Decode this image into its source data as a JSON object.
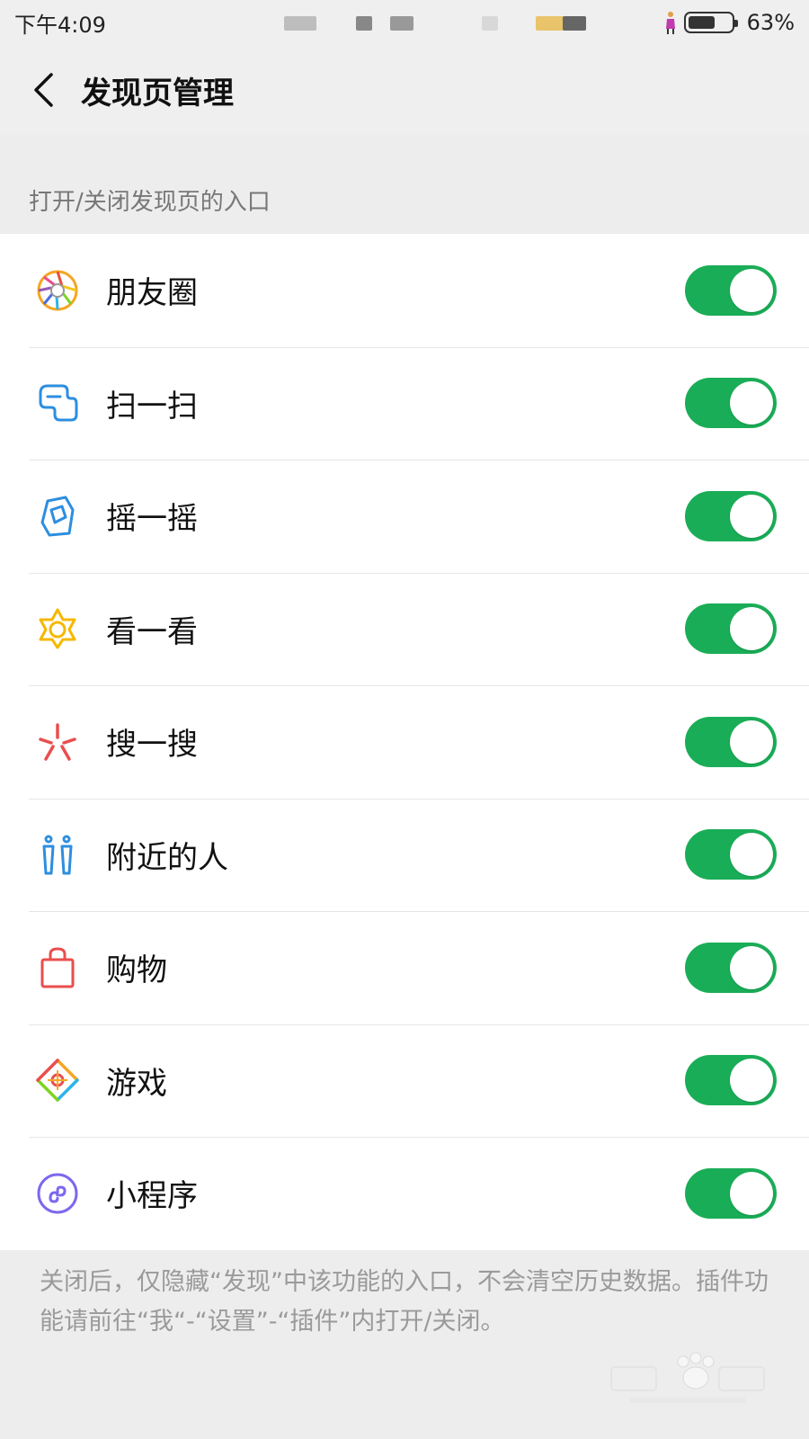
{
  "status": {
    "time": "下午4:09",
    "battery": "63%",
    "battery_level": 0.63
  },
  "nav": {
    "title": "发现页管理"
  },
  "section": {
    "header": "打开/关闭发现页的入口"
  },
  "items": [
    {
      "label": "朋友圈",
      "icon": "moments-icon",
      "enabled": true
    },
    {
      "label": "扫一扫",
      "icon": "scan-icon",
      "enabled": true
    },
    {
      "label": "摇一摇",
      "icon": "shake-icon",
      "enabled": true
    },
    {
      "label": "看一看",
      "icon": "top-stories-icon",
      "enabled": true
    },
    {
      "label": "搜一搜",
      "icon": "search-icon",
      "enabled": true
    },
    {
      "label": "附近的人",
      "icon": "people-nearby-icon",
      "enabled": true
    },
    {
      "label": "购物",
      "icon": "shopping-bag-icon",
      "enabled": true
    },
    {
      "label": "游戏",
      "icon": "games-icon",
      "enabled": true
    },
    {
      "label": "小程序",
      "icon": "mini-program-icon",
      "enabled": true
    }
  ],
  "footer": {
    "note": "关闭后，仅隐藏“发现”中该功能的入口，不会清空历史数据。插件功能请前往“我“-“设置”-“插件”内打开/关闭。"
  },
  "colors": {
    "toggle_on": "#1aad57",
    "background": "#ededed"
  }
}
